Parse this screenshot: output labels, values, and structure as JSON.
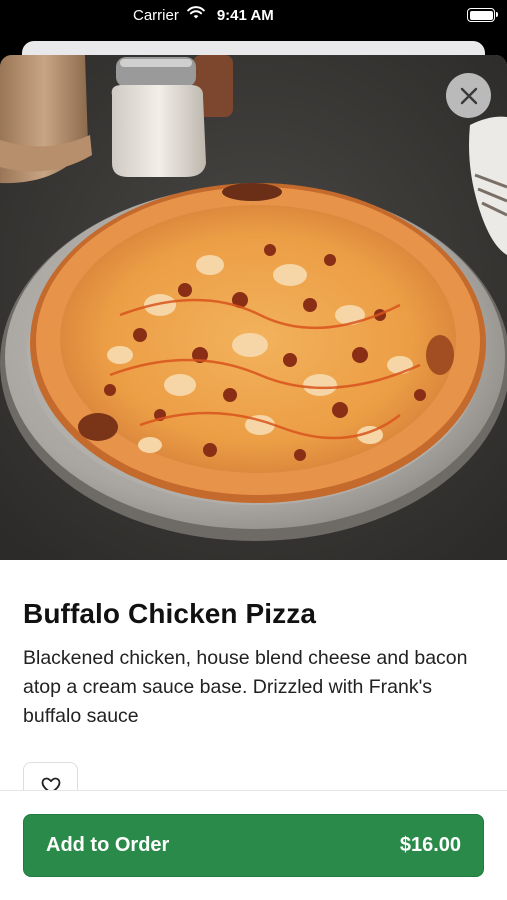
{
  "status_bar": {
    "carrier": "Carrier",
    "time": "9:41 AM"
  },
  "item": {
    "name": "Buffalo Chicken Pizza",
    "description": "Blackened chicken, house blend cheese and bacon atop a cream sauce base. Drizzled with Frank's buffalo sauce"
  },
  "icons": {
    "close": "close-icon",
    "favorite": "heart-outline-icon",
    "wifi": "wifi-icon",
    "battery": "battery-icon"
  },
  "order": {
    "label": "Add to Order",
    "price": "$16.00"
  },
  "colors": {
    "accent_green": "#2a8a4a"
  }
}
